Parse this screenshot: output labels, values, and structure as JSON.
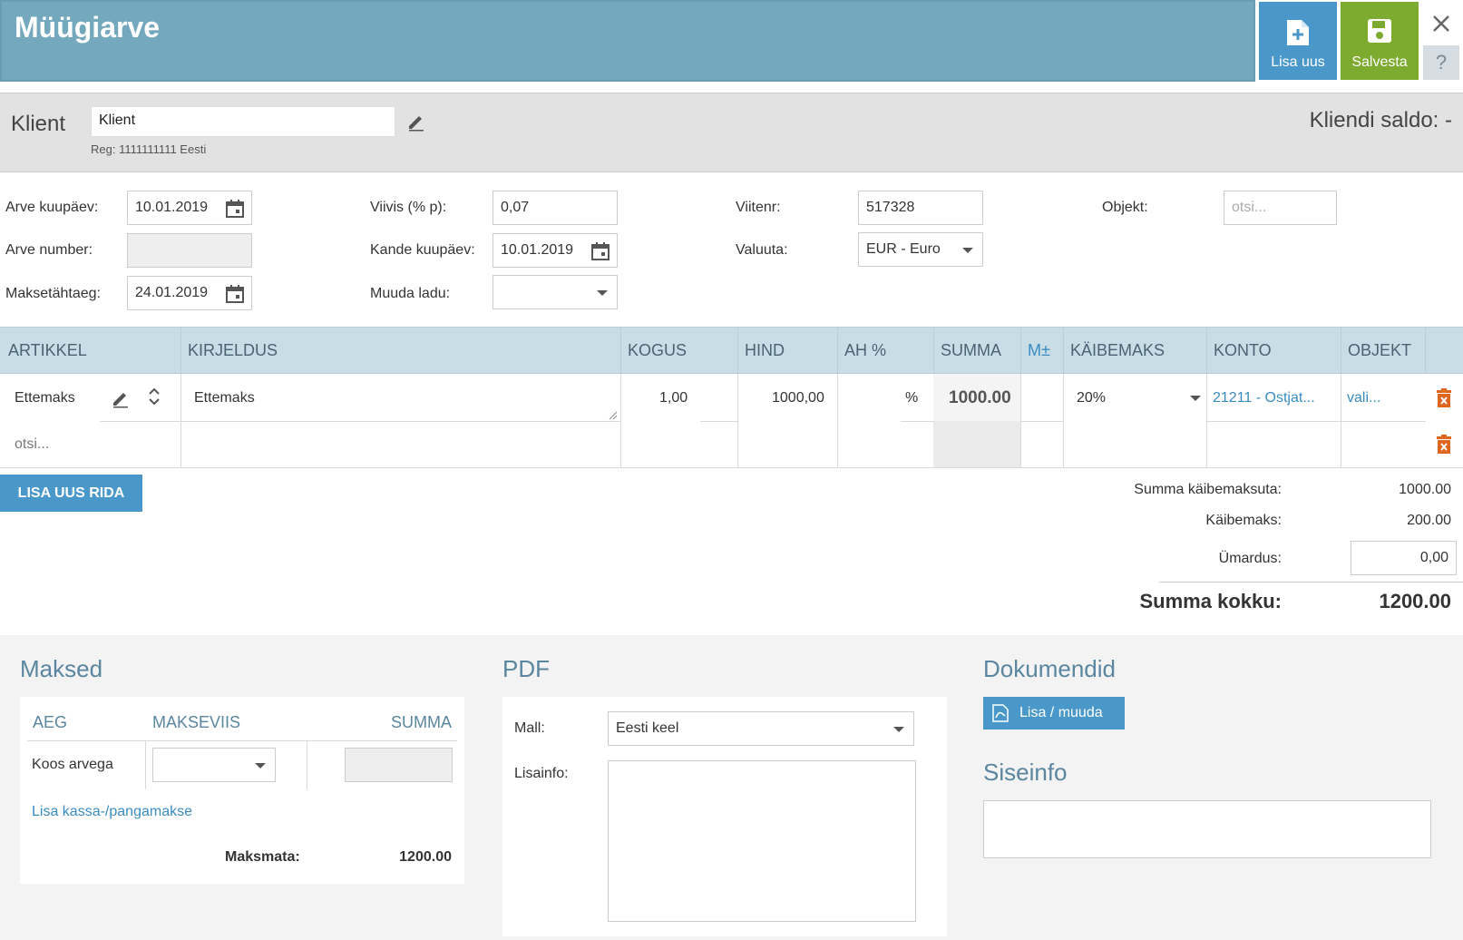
{
  "header": {
    "title": "Müügiarve",
    "new_label": "Lisa uus",
    "save_label": "Salvesta",
    "help": "?"
  },
  "client": {
    "label": "Klient",
    "value": "Klient",
    "reg": "Reg: 1111111111 Eesti",
    "balance": "Kliendi saldo: -"
  },
  "form": {
    "invoice_date_label": "Arve kuupäev:",
    "invoice_date": "10.01.2019",
    "invoice_number_label": "Arve number:",
    "due_date_label": "Maksetähtaeg:",
    "due_date": "24.01.2019",
    "penalty_label": "Viivis (% p):",
    "penalty": "0,07",
    "entry_date_label": "Kande kuupäev:",
    "entry_date": "10.01.2019",
    "warehouse_label": "Muuda ladu:",
    "reference_label": "Viitenr:",
    "reference": "517328",
    "currency_label": "Valuuta:",
    "currency": "EUR - Euro",
    "object_label": "Objekt:",
    "object_placeholder": "otsi..."
  },
  "table": {
    "columns": [
      "ARTIKKEL",
      "KIRJELDUS",
      "KOGUS",
      "HIND",
      "AH %",
      "SUMMA",
      "M±",
      "KÄIBEMAKS",
      "KONTO",
      "OBJEKT"
    ],
    "row": {
      "article": "Ettemaks",
      "description": "Ettemaks",
      "quantity": "1,00",
      "price": "1000,00",
      "discount_unit": "%",
      "sum": "1000.00",
      "vat": "20%",
      "account": "21211 - Ostjat...",
      "object": "vali..."
    },
    "new_row_placeholder": "otsi...",
    "add_row_label": "LISA UUS RIDA"
  },
  "totals": {
    "net_label": "Summa käibemaksuta:",
    "net": "1000.00",
    "vat_label": "Käibemaks:",
    "vat": "200.00",
    "rounding_label": "Ümardus:",
    "rounding": "0,00",
    "total_label": "Summa kokku:",
    "total": "1200.00"
  },
  "payments": {
    "title": "Maksed",
    "col_time": "AEG",
    "col_method": "MAKSEVIIS",
    "col_sum": "SUMMA",
    "row_label": "Koos arvega",
    "add_link": "Lisa kassa-/pangamakse",
    "unpaid_label": "Maksmata:",
    "unpaid": "1200.00"
  },
  "pdf": {
    "title": "PDF",
    "template_label": "Mall:",
    "template": "Eesti keel",
    "info_label": "Lisainfo:"
  },
  "documents": {
    "title": "Dokumendid",
    "add_label": "Lisa / muuda",
    "internal_title": "Siseinfo"
  }
}
